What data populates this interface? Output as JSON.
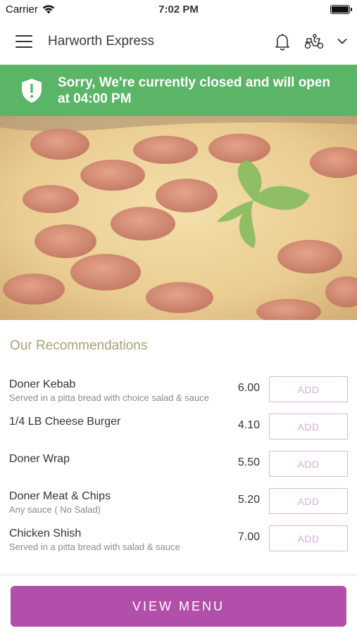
{
  "status_bar": {
    "carrier": "Carrier",
    "time": "7:02 PM"
  },
  "header": {
    "title": "Harworth Express"
  },
  "banner": {
    "text": "Sorry, We're currently closed and will open at 04:00 PM",
    "color": "#5bb566"
  },
  "section": {
    "title": "Our Recommendations"
  },
  "menu": [
    {
      "name": "Doner Kebab",
      "description": "Served in a pitta bread with choice salad & sauce",
      "price": "6.00",
      "add_label": "ADD"
    },
    {
      "name": "1/4 LB Cheese Burger",
      "description": "",
      "price": "4.10",
      "add_label": "ADD"
    },
    {
      "name": "Doner Wrap",
      "description": "",
      "price": "5.50",
      "add_label": "ADD"
    },
    {
      "name": "Doner Meat & Chips",
      "description": "Any sauce ( No Salad)",
      "price": "5.20",
      "add_label": "ADD"
    },
    {
      "name": "Chicken Shish",
      "description": "Served in a pitta bread with salad & sauce",
      "price": "7.00",
      "add_label": "ADD"
    }
  ],
  "footer": {
    "button_label": "VIEW MENU",
    "button_color": "#b24faa"
  },
  "icons": [
    "wifi-icon",
    "battery-icon",
    "menu-icon",
    "bell-icon",
    "delivery-scooter-icon",
    "chevron-down-icon",
    "shield-alert-icon"
  ]
}
